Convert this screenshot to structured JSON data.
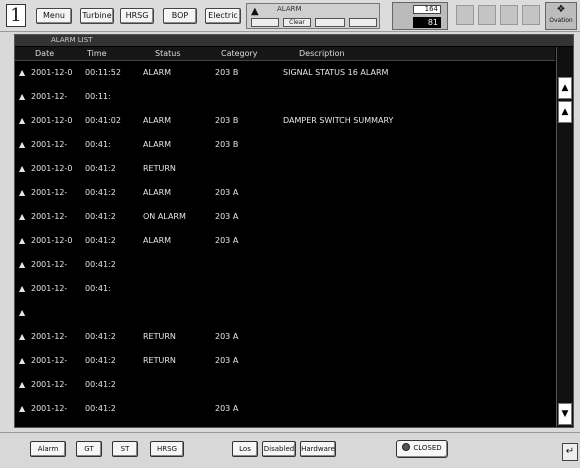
{
  "toolbar": {
    "page_number": "1",
    "nav": [
      "Menu",
      "Turbine",
      "HRSG",
      "BOP",
      "Electric"
    ],
    "alarm_control": {
      "title": "ALARM",
      "buttons": [
        "",
        "Clear",
        "",
        ""
      ]
    },
    "counter": {
      "top": "164",
      "bottom": "81"
    },
    "logo_label": "Ovation"
  },
  "window": {
    "title": "ALARM LIST"
  },
  "columns": {
    "date": "Date",
    "time": "Time",
    "status": "Status",
    "category": "Category",
    "description": "Description"
  },
  "alarms": [
    {
      "ack": "▲",
      "date": "2001-12-0",
      "time": "00:11:52",
      "status": "ALARM",
      "category": "203 B",
      "description": "SIGNAL STATUS 16 ALARM"
    },
    {
      "ack": "▲",
      "date": "2001-12-",
      "time": "00:11:",
      "status": "",
      "category": "",
      "description": ""
    },
    {
      "ack": "▲",
      "date": "2001-12-0",
      "time": "00:41:02",
      "status": "ALARM",
      "category": "203 B",
      "description": "DAMPER SWITCH SUMMARY"
    },
    {
      "ack": "▲",
      "date": "2001-12-",
      "time": "00:41:",
      "status": "ALARM",
      "category": "203 B",
      "description": ""
    },
    {
      "ack": "▲",
      "date": "2001-12-0",
      "time": "00:41:2",
      "status": "RETURN",
      "category": "",
      "description": ""
    },
    {
      "ack": "▲",
      "date": "2001-12-",
      "time": "00:41:2",
      "status": "ALARM",
      "category": "203 A",
      "description": ""
    },
    {
      "ack": "▲",
      "date": "2001-12-",
      "time": "00:41:2",
      "status": "ON ALARM",
      "category": "203 A",
      "description": ""
    },
    {
      "ack": "▲",
      "date": "2001-12-0",
      "time": "00:41:2",
      "status": "ALARM",
      "category": "203 A",
      "description": ""
    },
    {
      "ack": "▲",
      "date": "2001-12-",
      "time": "00:41:2",
      "status": "",
      "category": "",
      "description": ""
    },
    {
      "ack": "▲",
      "date": "2001-12-",
      "time": "00:41:",
      "status": "",
      "category": "",
      "description": ""
    },
    {
      "ack": "▲",
      "date": "",
      "time": "",
      "status": "",
      "category": "",
      "description": ""
    },
    {
      "ack": "▲",
      "date": "2001-12-",
      "time": "00:41:2",
      "status": "RETURN",
      "category": "203 A",
      "description": ""
    },
    {
      "ack": "▲",
      "date": "2001-12-",
      "time": "00:41:2",
      "status": "RETURN",
      "category": "203 A",
      "description": ""
    },
    {
      "ack": "▲",
      "date": "2001-12-",
      "time": "00:41:2",
      "status": "",
      "category": "",
      "description": ""
    },
    {
      "ack": "▲",
      "date": "2001-12-",
      "time": "00:41:2",
      "status": "",
      "category": "203 A",
      "description": ""
    }
  ],
  "scrollbar": {
    "up": "▲",
    "up2": "▲",
    "down": "▼"
  },
  "bottom": {
    "alarm": "Alarm",
    "gt": "GT",
    "st": "ST",
    "hrsg": "HRSG",
    "los": "Los",
    "disabled": "Disabled",
    "hardware": "Hardware",
    "closed": "CLOSED",
    "sys_info": [
      "",
      "",
      ""
    ],
    "corner": "↵"
  },
  "colors": {
    "window_bg": "#000000",
    "row_text": "#e6e6e6",
    "toolbar_bg": "#dcdcdc"
  }
}
